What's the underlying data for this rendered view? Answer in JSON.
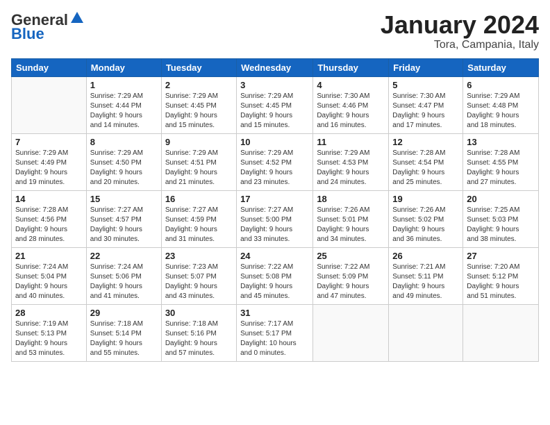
{
  "logo": {
    "general": "General",
    "blue": "Blue"
  },
  "header": {
    "title": "January 2024",
    "subtitle": "Tora, Campania, Italy"
  },
  "weekdays": [
    "Sunday",
    "Monday",
    "Tuesday",
    "Wednesday",
    "Thursday",
    "Friday",
    "Saturday"
  ],
  "weeks": [
    [
      {
        "day": "",
        "info": ""
      },
      {
        "day": "1",
        "info": "Sunrise: 7:29 AM\nSunset: 4:44 PM\nDaylight: 9 hours\nand 14 minutes."
      },
      {
        "day": "2",
        "info": "Sunrise: 7:29 AM\nSunset: 4:45 PM\nDaylight: 9 hours\nand 15 minutes."
      },
      {
        "day": "3",
        "info": "Sunrise: 7:29 AM\nSunset: 4:45 PM\nDaylight: 9 hours\nand 15 minutes."
      },
      {
        "day": "4",
        "info": "Sunrise: 7:30 AM\nSunset: 4:46 PM\nDaylight: 9 hours\nand 16 minutes."
      },
      {
        "day": "5",
        "info": "Sunrise: 7:30 AM\nSunset: 4:47 PM\nDaylight: 9 hours\nand 17 minutes."
      },
      {
        "day": "6",
        "info": "Sunrise: 7:29 AM\nSunset: 4:48 PM\nDaylight: 9 hours\nand 18 minutes."
      }
    ],
    [
      {
        "day": "7",
        "info": "Sunrise: 7:29 AM\nSunset: 4:49 PM\nDaylight: 9 hours\nand 19 minutes."
      },
      {
        "day": "8",
        "info": "Sunrise: 7:29 AM\nSunset: 4:50 PM\nDaylight: 9 hours\nand 20 minutes."
      },
      {
        "day": "9",
        "info": "Sunrise: 7:29 AM\nSunset: 4:51 PM\nDaylight: 9 hours\nand 21 minutes."
      },
      {
        "day": "10",
        "info": "Sunrise: 7:29 AM\nSunset: 4:52 PM\nDaylight: 9 hours\nand 23 minutes."
      },
      {
        "day": "11",
        "info": "Sunrise: 7:29 AM\nSunset: 4:53 PM\nDaylight: 9 hours\nand 24 minutes."
      },
      {
        "day": "12",
        "info": "Sunrise: 7:28 AM\nSunset: 4:54 PM\nDaylight: 9 hours\nand 25 minutes."
      },
      {
        "day": "13",
        "info": "Sunrise: 7:28 AM\nSunset: 4:55 PM\nDaylight: 9 hours\nand 27 minutes."
      }
    ],
    [
      {
        "day": "14",
        "info": "Sunrise: 7:28 AM\nSunset: 4:56 PM\nDaylight: 9 hours\nand 28 minutes."
      },
      {
        "day": "15",
        "info": "Sunrise: 7:27 AM\nSunset: 4:57 PM\nDaylight: 9 hours\nand 30 minutes."
      },
      {
        "day": "16",
        "info": "Sunrise: 7:27 AM\nSunset: 4:59 PM\nDaylight: 9 hours\nand 31 minutes."
      },
      {
        "day": "17",
        "info": "Sunrise: 7:27 AM\nSunset: 5:00 PM\nDaylight: 9 hours\nand 33 minutes."
      },
      {
        "day": "18",
        "info": "Sunrise: 7:26 AM\nSunset: 5:01 PM\nDaylight: 9 hours\nand 34 minutes."
      },
      {
        "day": "19",
        "info": "Sunrise: 7:26 AM\nSunset: 5:02 PM\nDaylight: 9 hours\nand 36 minutes."
      },
      {
        "day": "20",
        "info": "Sunrise: 7:25 AM\nSunset: 5:03 PM\nDaylight: 9 hours\nand 38 minutes."
      }
    ],
    [
      {
        "day": "21",
        "info": "Sunrise: 7:24 AM\nSunset: 5:04 PM\nDaylight: 9 hours\nand 40 minutes."
      },
      {
        "day": "22",
        "info": "Sunrise: 7:24 AM\nSunset: 5:06 PM\nDaylight: 9 hours\nand 41 minutes."
      },
      {
        "day": "23",
        "info": "Sunrise: 7:23 AM\nSunset: 5:07 PM\nDaylight: 9 hours\nand 43 minutes."
      },
      {
        "day": "24",
        "info": "Sunrise: 7:22 AM\nSunset: 5:08 PM\nDaylight: 9 hours\nand 45 minutes."
      },
      {
        "day": "25",
        "info": "Sunrise: 7:22 AM\nSunset: 5:09 PM\nDaylight: 9 hours\nand 47 minutes."
      },
      {
        "day": "26",
        "info": "Sunrise: 7:21 AM\nSunset: 5:11 PM\nDaylight: 9 hours\nand 49 minutes."
      },
      {
        "day": "27",
        "info": "Sunrise: 7:20 AM\nSunset: 5:12 PM\nDaylight: 9 hours\nand 51 minutes."
      }
    ],
    [
      {
        "day": "28",
        "info": "Sunrise: 7:19 AM\nSunset: 5:13 PM\nDaylight: 9 hours\nand 53 minutes."
      },
      {
        "day": "29",
        "info": "Sunrise: 7:18 AM\nSunset: 5:14 PM\nDaylight: 9 hours\nand 55 minutes."
      },
      {
        "day": "30",
        "info": "Sunrise: 7:18 AM\nSunset: 5:16 PM\nDaylight: 9 hours\nand 57 minutes."
      },
      {
        "day": "31",
        "info": "Sunrise: 7:17 AM\nSunset: 5:17 PM\nDaylight: 10 hours\nand 0 minutes."
      },
      {
        "day": "",
        "info": ""
      },
      {
        "day": "",
        "info": ""
      },
      {
        "day": "",
        "info": ""
      }
    ]
  ]
}
